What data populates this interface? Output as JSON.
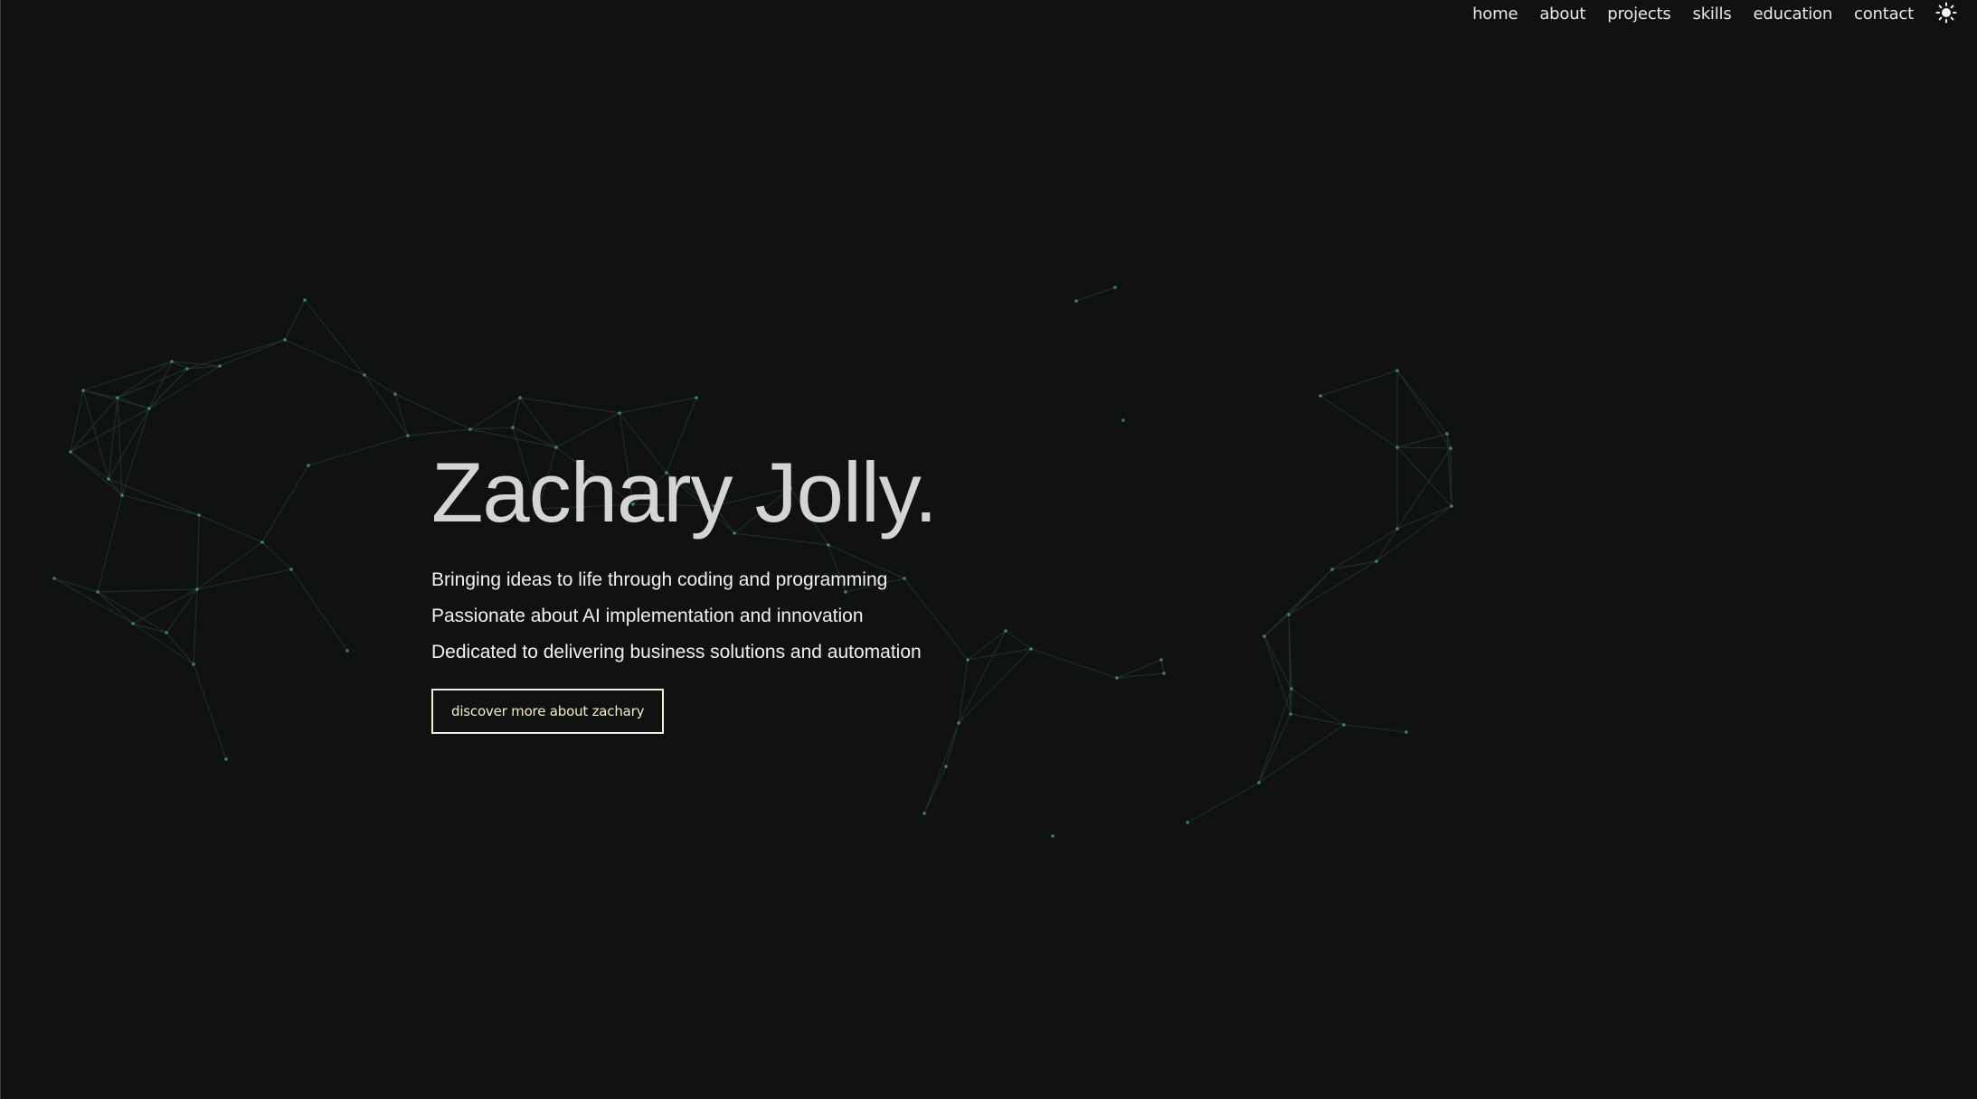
{
  "nav": {
    "items": [
      {
        "label": "home"
      },
      {
        "label": "about"
      },
      {
        "label": "projects"
      },
      {
        "label": "skills"
      },
      {
        "label": "education"
      },
      {
        "label": "contact"
      }
    ],
    "theme_toggle_icon": "sun-icon"
  },
  "hero": {
    "title": "Zachary Jolly.",
    "taglines": [
      "Bringing ideas to life through coding and programming",
      "Passionate about AI implementation and innovation",
      "Dedicated to delivering business solutions and automation"
    ],
    "cta_label": "discover more about zachary"
  },
  "colors": {
    "background": "#101211",
    "title": "#d4d4d4",
    "text": "#f0f0f0",
    "accent": "#f2ecc9",
    "network": "#4fc7a0"
  }
}
